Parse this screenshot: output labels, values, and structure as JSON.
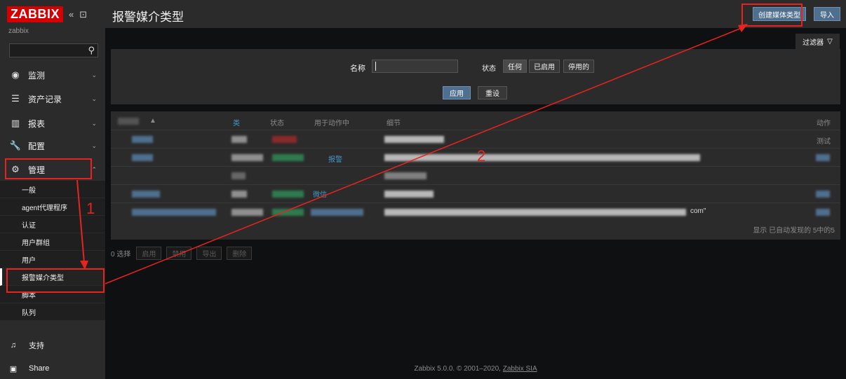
{
  "sidebar": {
    "logo": "ZABBIX",
    "server_name": "zabbix",
    "collapse_icon": "«",
    "kiosk_icon": "⊡",
    "search_icon": "⚲",
    "menu": [
      {
        "label": "监测",
        "icon": "eye-icon"
      },
      {
        "label": "资产记录",
        "icon": "list-icon"
      },
      {
        "label": "报表",
        "icon": "chart-icon"
      },
      {
        "label": "配置",
        "icon": "wrench-icon"
      },
      {
        "label": "管理",
        "icon": "gear-icon"
      }
    ],
    "admin_submenu": [
      "一般",
      "agent代理程序",
      "认证",
      "用户群组",
      "用户",
      "报警媒介类型",
      "脚本",
      "队列"
    ],
    "support_label": "支持",
    "share_label": "Share"
  },
  "header": {
    "title": "报警媒介类型",
    "create_button": "创建媒体类型",
    "import_button": "导入"
  },
  "filter": {
    "tab_label": "过滤器",
    "name_label": "名称",
    "name_value": "",
    "status_label": "状态",
    "status_options": [
      "任何",
      "已启用",
      "停用的"
    ],
    "status_selected": "任何",
    "apply_button": "应用",
    "reset_button": "重设"
  },
  "table": {
    "headers": {
      "name": "▲",
      "type": "类",
      "status": "状态",
      "used_in_actions": "用于动作中",
      "details": "细节",
      "action": "动作"
    },
    "action_cell": "测试",
    "visible_links": [
      "报警",
      "微信"
    ],
    "visible_detail_fragment": "com\"",
    "footer": "显示 已自动发现的 5中的5"
  },
  "mass_actions": {
    "selected_count": "0 选择",
    "buttons": [
      "启用",
      "禁用",
      "导出",
      "删除"
    ]
  },
  "footer": {
    "text": "Zabbix 5.0.0. © 2001–2020,",
    "company": "Zabbix SIA"
  },
  "annotations": {
    "step1": "1",
    "step2": "2",
    "color": "#e8231f"
  },
  "colors": {
    "accent": "#4f6f8f",
    "logo_red": "#d40000",
    "sidebar_bg": "#2b2b2b",
    "page_bg": "#0e1012"
  }
}
